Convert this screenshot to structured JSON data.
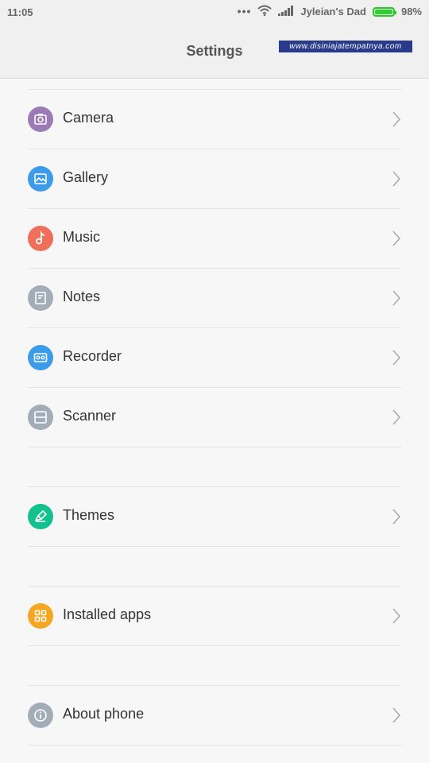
{
  "status": {
    "time": "11:05",
    "more": "•••",
    "carrier": "Jyleian's Dad",
    "battery_pct": "98%",
    "battery_level": 0.98
  },
  "header": {
    "title": "Settings",
    "watermark": "www.disiniajatempatnya.com"
  },
  "items": [
    {
      "label": "Camera",
      "icon": "camera-icon",
      "color": "#9b7bb5"
    },
    {
      "label": "Gallery",
      "icon": "gallery-icon",
      "color": "#3d9bea"
    },
    {
      "label": "Music",
      "icon": "music-icon",
      "color": "#f06f5b"
    },
    {
      "label": "Notes",
      "icon": "notes-icon",
      "color": "#a3adb8"
    },
    {
      "label": "Recorder",
      "icon": "recorder-icon",
      "color": "#3d9bea"
    },
    {
      "label": "Scanner",
      "icon": "scanner-icon",
      "color": "#a3adb8"
    },
    {
      "label": "Themes",
      "icon": "themes-icon",
      "color": "#14c08e"
    },
    {
      "label": "Installed apps",
      "icon": "apps-grid-icon",
      "color": "#f5a623"
    },
    {
      "label": "About phone",
      "icon": "info-icon",
      "color": "#a3adb8"
    }
  ]
}
